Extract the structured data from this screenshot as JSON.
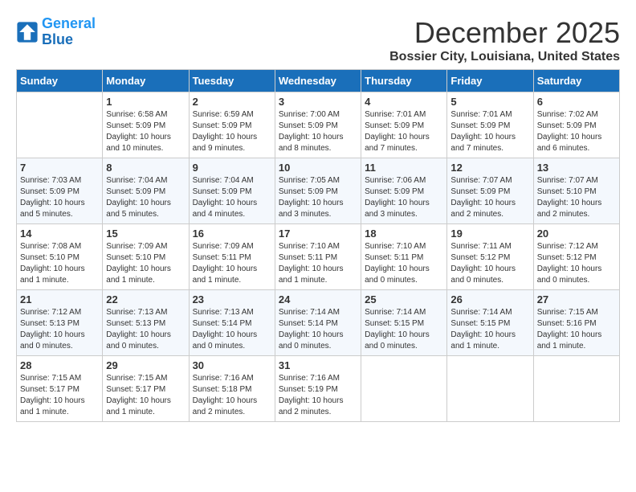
{
  "header": {
    "logo_line1": "General",
    "logo_line2": "Blue",
    "month": "December 2025",
    "location": "Bossier City, Louisiana, United States"
  },
  "weekdays": [
    "Sunday",
    "Monday",
    "Tuesday",
    "Wednesday",
    "Thursday",
    "Friday",
    "Saturday"
  ],
  "weeks": [
    [
      {
        "day": "",
        "info": ""
      },
      {
        "day": "1",
        "info": "Sunrise: 6:58 AM\nSunset: 5:09 PM\nDaylight: 10 hours\nand 10 minutes."
      },
      {
        "day": "2",
        "info": "Sunrise: 6:59 AM\nSunset: 5:09 PM\nDaylight: 10 hours\nand 9 minutes."
      },
      {
        "day": "3",
        "info": "Sunrise: 7:00 AM\nSunset: 5:09 PM\nDaylight: 10 hours\nand 8 minutes."
      },
      {
        "day": "4",
        "info": "Sunrise: 7:01 AM\nSunset: 5:09 PM\nDaylight: 10 hours\nand 7 minutes."
      },
      {
        "day": "5",
        "info": "Sunrise: 7:01 AM\nSunset: 5:09 PM\nDaylight: 10 hours\nand 7 minutes."
      },
      {
        "day": "6",
        "info": "Sunrise: 7:02 AM\nSunset: 5:09 PM\nDaylight: 10 hours\nand 6 minutes."
      }
    ],
    [
      {
        "day": "7",
        "info": "Sunrise: 7:03 AM\nSunset: 5:09 PM\nDaylight: 10 hours\nand 5 minutes."
      },
      {
        "day": "8",
        "info": "Sunrise: 7:04 AM\nSunset: 5:09 PM\nDaylight: 10 hours\nand 5 minutes."
      },
      {
        "day": "9",
        "info": "Sunrise: 7:04 AM\nSunset: 5:09 PM\nDaylight: 10 hours\nand 4 minutes."
      },
      {
        "day": "10",
        "info": "Sunrise: 7:05 AM\nSunset: 5:09 PM\nDaylight: 10 hours\nand 3 minutes."
      },
      {
        "day": "11",
        "info": "Sunrise: 7:06 AM\nSunset: 5:09 PM\nDaylight: 10 hours\nand 3 minutes."
      },
      {
        "day": "12",
        "info": "Sunrise: 7:07 AM\nSunset: 5:09 PM\nDaylight: 10 hours\nand 2 minutes."
      },
      {
        "day": "13",
        "info": "Sunrise: 7:07 AM\nSunset: 5:10 PM\nDaylight: 10 hours\nand 2 minutes."
      }
    ],
    [
      {
        "day": "14",
        "info": "Sunrise: 7:08 AM\nSunset: 5:10 PM\nDaylight: 10 hours\nand 1 minute."
      },
      {
        "day": "15",
        "info": "Sunrise: 7:09 AM\nSunset: 5:10 PM\nDaylight: 10 hours\nand 1 minute."
      },
      {
        "day": "16",
        "info": "Sunrise: 7:09 AM\nSunset: 5:11 PM\nDaylight: 10 hours\nand 1 minute."
      },
      {
        "day": "17",
        "info": "Sunrise: 7:10 AM\nSunset: 5:11 PM\nDaylight: 10 hours\nand 1 minute."
      },
      {
        "day": "18",
        "info": "Sunrise: 7:10 AM\nSunset: 5:11 PM\nDaylight: 10 hours\nand 0 minutes."
      },
      {
        "day": "19",
        "info": "Sunrise: 7:11 AM\nSunset: 5:12 PM\nDaylight: 10 hours\nand 0 minutes."
      },
      {
        "day": "20",
        "info": "Sunrise: 7:12 AM\nSunset: 5:12 PM\nDaylight: 10 hours\nand 0 minutes."
      }
    ],
    [
      {
        "day": "21",
        "info": "Sunrise: 7:12 AM\nSunset: 5:13 PM\nDaylight: 10 hours\nand 0 minutes."
      },
      {
        "day": "22",
        "info": "Sunrise: 7:13 AM\nSunset: 5:13 PM\nDaylight: 10 hours\nand 0 minutes."
      },
      {
        "day": "23",
        "info": "Sunrise: 7:13 AM\nSunset: 5:14 PM\nDaylight: 10 hours\nand 0 minutes."
      },
      {
        "day": "24",
        "info": "Sunrise: 7:14 AM\nSunset: 5:14 PM\nDaylight: 10 hours\nand 0 minutes."
      },
      {
        "day": "25",
        "info": "Sunrise: 7:14 AM\nSunset: 5:15 PM\nDaylight: 10 hours\nand 0 minutes."
      },
      {
        "day": "26",
        "info": "Sunrise: 7:14 AM\nSunset: 5:15 PM\nDaylight: 10 hours\nand 1 minute."
      },
      {
        "day": "27",
        "info": "Sunrise: 7:15 AM\nSunset: 5:16 PM\nDaylight: 10 hours\nand 1 minute."
      }
    ],
    [
      {
        "day": "28",
        "info": "Sunrise: 7:15 AM\nSunset: 5:17 PM\nDaylight: 10 hours\nand 1 minute."
      },
      {
        "day": "29",
        "info": "Sunrise: 7:15 AM\nSunset: 5:17 PM\nDaylight: 10 hours\nand 1 minute."
      },
      {
        "day": "30",
        "info": "Sunrise: 7:16 AM\nSunset: 5:18 PM\nDaylight: 10 hours\nand 2 minutes."
      },
      {
        "day": "31",
        "info": "Sunrise: 7:16 AM\nSunset: 5:19 PM\nDaylight: 10 hours\nand 2 minutes."
      },
      {
        "day": "",
        "info": ""
      },
      {
        "day": "",
        "info": ""
      },
      {
        "day": "",
        "info": ""
      }
    ]
  ]
}
